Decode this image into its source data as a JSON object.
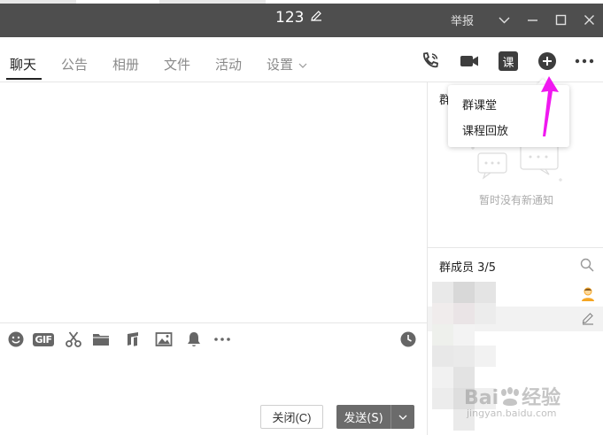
{
  "titlebar": {
    "title": "123",
    "report_label": "举报"
  },
  "tabs": [
    {
      "label": "聊天",
      "active": true
    },
    {
      "label": "公告",
      "active": false
    },
    {
      "label": "相册",
      "active": false
    },
    {
      "label": "文件",
      "active": false
    },
    {
      "label": "活动",
      "active": false
    },
    {
      "label": "设置",
      "active": false
    }
  ],
  "toolbar": {
    "class_label": "课"
  },
  "dropdown": {
    "items": [
      "群课堂",
      "课程回放"
    ]
  },
  "notice": {
    "title": "群",
    "empty_text": "暂时没有新通知"
  },
  "members": {
    "title": "群成员 3/5"
  },
  "composer": {
    "gif_label": "GIF",
    "close_label": "关闭(C)",
    "send_label": "发送(S)"
  },
  "watermark": {
    "brand": "Bai",
    "brand2": "经验",
    "url": "jingyan.baidu.com"
  },
  "colors": {
    "titlebar_bg": "#4e4e4e",
    "send_bg": "#6b6b6b",
    "arrow_magenta": "#f018f0",
    "avatar_orange": "#f5a623"
  }
}
